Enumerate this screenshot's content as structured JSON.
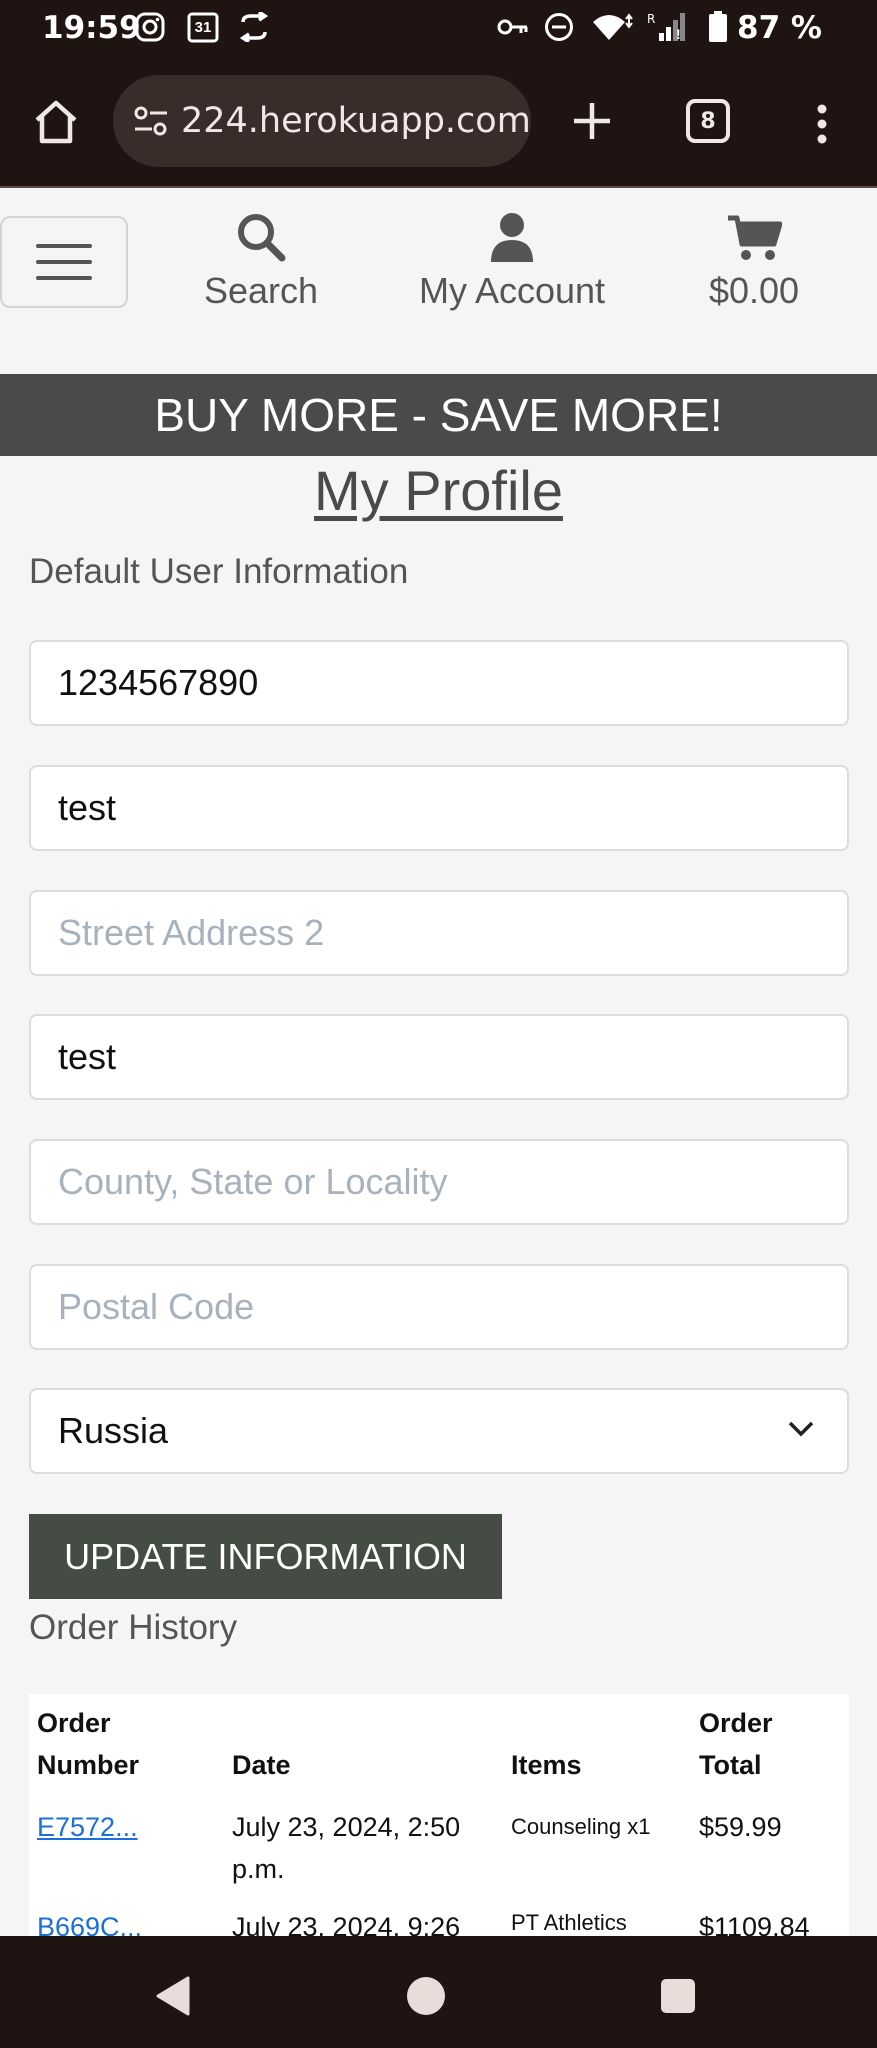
{
  "status_bar": {
    "time": "19:59",
    "battery_percent": "87 %",
    "calendar_day": "31"
  },
  "browser": {
    "url": "224.herokuapp.com",
    "tab_count": "8"
  },
  "site_nav": {
    "search_label": "Search",
    "account_label": "My Account",
    "cart_total": "$0.00"
  },
  "banner": "BUY MORE - SAVE MORE!",
  "page_title": "My Profile",
  "default_info_heading": "Default User Information",
  "fields": {
    "field1_value": "1234567890",
    "field2_value": "test",
    "street2_placeholder": "Street Address 2",
    "field4_value": "test",
    "county_placeholder": "County, State or Locality",
    "postal_placeholder": "Postal Code",
    "country_selected": "Russia"
  },
  "update_button": "UPDATE INFORMATION",
  "order_history_heading": "Order History",
  "orders": {
    "headers": {
      "order_number_line1": "Order",
      "order_number_line2": "Number",
      "date": "Date",
      "items": "Items",
      "total_line1": "Order",
      "total_line2": "Total"
    },
    "rows": [
      {
        "number": "E7572...",
        "date_line1": "July 23, 2024, 2:50",
        "date_line2": "p.m.",
        "items": "Counseling x1",
        "total": "$59.99"
      },
      {
        "number": "B669C...",
        "date_line1": "July 23, 2024, 9:26",
        "date_line2": "",
        "items": "PT Athletics",
        "total": "$1109.84"
      }
    ]
  },
  "colors": {
    "chrome_bg": "#1f1412",
    "banner_bg": "#4a4a4a",
    "button_bg": "#444c43",
    "link": "#1a6fd8"
  }
}
